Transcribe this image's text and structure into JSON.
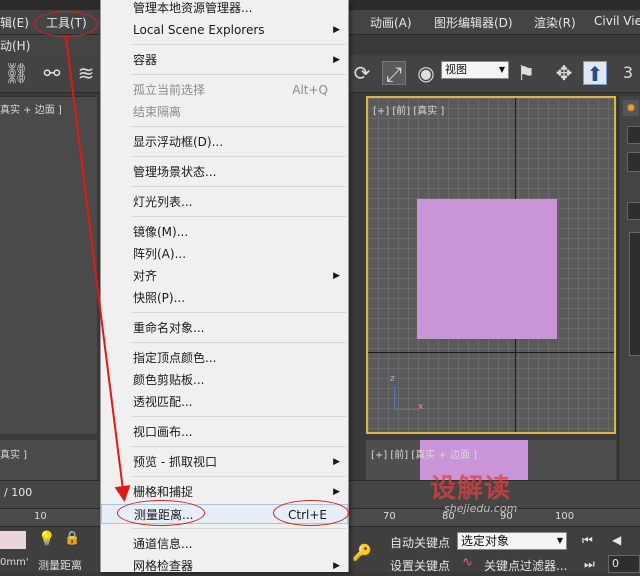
{
  "menubar": {
    "left_items": [
      "辑(E)",
      "工具(T)"
    ],
    "right_items": [
      "动画(A)",
      "图形编辑器(D)",
      "渲染(R)",
      "Civil Vie"
    ],
    "second_row": "动(H)"
  },
  "toolbar": {
    "view_select": "视图",
    "right_digit": "3"
  },
  "viewports": {
    "left_top_label": "真实 + 边面 ]",
    "right_top_label": "[+] [前] [真实 ]",
    "left_bottom_label": "真实 ]",
    "right_bottom_label": "[+] [前] [真实 + 边面 ]",
    "axis_z": "z",
    "axis_x": "x",
    "colors": {
      "object": "#c994d8",
      "active_border": "#d8b64a"
    }
  },
  "dropdown": {
    "items": [
      {
        "label": "管理本地资源管理器...",
        "shortcut": "",
        "submenu": false,
        "disabled": false
      },
      {
        "label": "Local Scene Explorers",
        "shortcut": "",
        "submenu": true,
        "disabled": false
      },
      {
        "label": "容器",
        "shortcut": "",
        "submenu": true,
        "disabled": false
      },
      {
        "label": "孤立当前选择",
        "shortcut": "Alt+Q",
        "submenu": false,
        "disabled": true
      },
      {
        "label": "结束隔离",
        "shortcut": "",
        "submenu": false,
        "disabled": true
      },
      {
        "label": "显示浮动框(D)...",
        "shortcut": "",
        "submenu": false,
        "disabled": false
      },
      {
        "label": "管理场景状态...",
        "shortcut": "",
        "submenu": false,
        "disabled": false
      },
      {
        "label": "灯光列表...",
        "shortcut": "",
        "submenu": false,
        "disabled": false
      },
      {
        "label": "镜像(M)...",
        "shortcut": "",
        "submenu": false,
        "disabled": false
      },
      {
        "label": "阵列(A)...",
        "shortcut": "",
        "submenu": false,
        "disabled": false
      },
      {
        "label": "对齐",
        "shortcut": "",
        "submenu": true,
        "disabled": false
      },
      {
        "label": "快照(P)...",
        "shortcut": "",
        "submenu": false,
        "disabled": false
      },
      {
        "label": "重命名对象...",
        "shortcut": "",
        "submenu": false,
        "disabled": false
      },
      {
        "label": "指定顶点颜色...",
        "shortcut": "",
        "submenu": false,
        "disabled": false
      },
      {
        "label": "颜色剪贴板...",
        "shortcut": "",
        "submenu": false,
        "disabled": false
      },
      {
        "label": "透视匹配...",
        "shortcut": "",
        "submenu": false,
        "disabled": false
      },
      {
        "label": "视口画布...",
        "shortcut": "",
        "submenu": false,
        "disabled": false
      },
      {
        "label": "预览 - 抓取视口",
        "shortcut": "",
        "submenu": true,
        "disabled": false
      },
      {
        "label": "栅格和捕捉",
        "shortcut": "",
        "submenu": true,
        "disabled": false
      },
      {
        "label": "测量距离...",
        "shortcut": "Ctrl+E",
        "submenu": false,
        "disabled": false
      },
      {
        "label": "通道信息...",
        "shortcut": "",
        "submenu": false,
        "disabled": false
      },
      {
        "label": "网格检查器",
        "shortcut": "",
        "submenu": true,
        "disabled": false
      }
    ]
  },
  "timeline": {
    "frame_counter": "/ 100",
    "ruler_ticks": [
      "10",
      "70",
      "80",
      "90",
      "100"
    ]
  },
  "statusbar": {
    "auto_key": "自动关键点",
    "set_key": "设置关键点",
    "selected_object": "选定对象",
    "key_filters": "关键点过滤器...",
    "frame_value": "0",
    "left_value": "0mm'",
    "left_bottom_text": "测量距离"
  },
  "watermark": {
    "text": "设解读",
    "url": "shejiedu.com"
  }
}
